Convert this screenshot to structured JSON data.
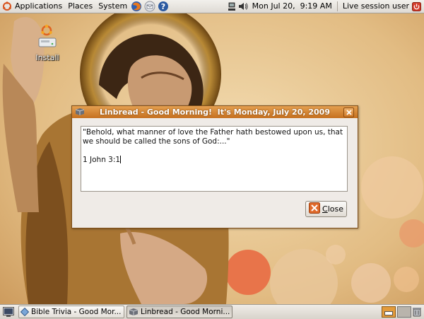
{
  "top_panel": {
    "menus": [
      "Applications",
      "Places",
      "System"
    ],
    "clock": "Mon Jul 20,  9:19 AM",
    "user": "Live session user"
  },
  "desktop": {
    "icons": [
      {
        "label": "Install"
      }
    ]
  },
  "dialog": {
    "title": "Linbread - Good Morning!  It's Monday, July 20, 2009",
    "quote": "\"Behold, what manner of love the Father hath bestowed upon us, that we should be called the sons of God:...\"",
    "reference": "1 John 3:1",
    "close_button_label": "Close"
  },
  "taskbar": {
    "tasks": [
      {
        "label": "Bible Trivia - Good Mor..."
      },
      {
        "label": "Linbread - Good Morni..."
      }
    ]
  },
  "colors": {
    "titlebar": "#d4832f",
    "wallpaper": "#d9b37a",
    "accent_circle": "#e8744a"
  }
}
